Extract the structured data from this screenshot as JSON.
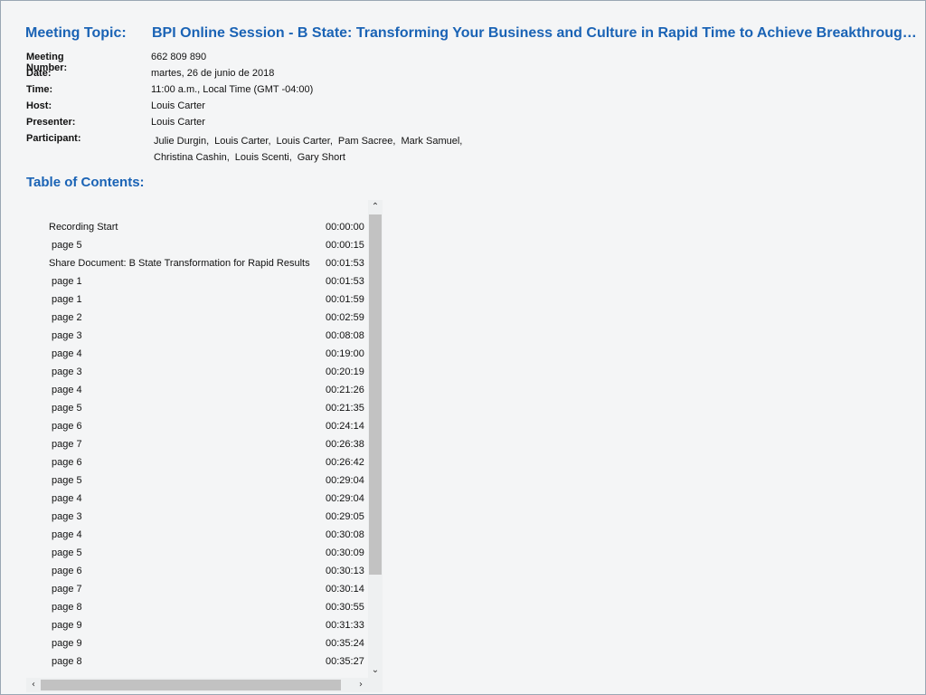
{
  "meeting": {
    "topic_label": "Meeting Topic:",
    "topic_value": "BPI Online Session - B State: Transforming Your Business and Culture in Rapid Time to Achieve Breakthrough Me...",
    "info": [
      {
        "label": "Meeting Number:",
        "value": "662 809 890"
      },
      {
        "label": "Date:",
        "value": "martes, 26 de junio de 2018"
      },
      {
        "label": "Time:",
        "value": "11:00 a.m., Local Time (GMT -04:00)"
      },
      {
        "label": "Host:",
        "value": "Louis Carter"
      },
      {
        "label": "Presenter:",
        "value": "Louis Carter"
      }
    ],
    "participant_label": "Participant:",
    "participants": [
      "Julie Durgin,",
      "Louis Carter,",
      "Louis Carter,",
      "Pam Sacree,",
      "Mark Samuel,",
      "Christina Cashin,",
      "Louis Scenti,",
      "Gary Short"
    ]
  },
  "toc": {
    "title": "Table of Contents:",
    "items": [
      {
        "name": "Recording Start",
        "time": "00:00:00",
        "indent": false
      },
      {
        "name": "page 5",
        "time": "00:00:15",
        "indent": true
      },
      {
        "name": "Share Document: B State Transformation for Rapid Results",
        "time": "00:01:53",
        "indent": false
      },
      {
        "name": "page 1",
        "time": "00:01:53",
        "indent": true
      },
      {
        "name": "page 1",
        "time": "00:01:59",
        "indent": true
      },
      {
        "name": "page 2",
        "time": "00:02:59",
        "indent": true
      },
      {
        "name": "page 3",
        "time": "00:08:08",
        "indent": true
      },
      {
        "name": "page 4",
        "time": "00:19:00",
        "indent": true
      },
      {
        "name": "page 3",
        "time": "00:20:19",
        "indent": true
      },
      {
        "name": "page 4",
        "time": "00:21:26",
        "indent": true
      },
      {
        "name": "page 5",
        "time": "00:21:35",
        "indent": true
      },
      {
        "name": "page 6",
        "time": "00:24:14",
        "indent": true
      },
      {
        "name": "page 7",
        "time": "00:26:38",
        "indent": true
      },
      {
        "name": "page 6",
        "time": "00:26:42",
        "indent": true
      },
      {
        "name": "page 5",
        "time": "00:29:04",
        "indent": true
      },
      {
        "name": "page 4",
        "time": "00:29:04",
        "indent": true
      },
      {
        "name": "page 3",
        "time": "00:29:05",
        "indent": true
      },
      {
        "name": "page 4",
        "time": "00:30:08",
        "indent": true
      },
      {
        "name": "page 5",
        "time": "00:30:09",
        "indent": true
      },
      {
        "name": "page 6",
        "time": "00:30:13",
        "indent": true
      },
      {
        "name": "page 7",
        "time": "00:30:14",
        "indent": true
      },
      {
        "name": "page 8",
        "time": "00:30:55",
        "indent": true
      },
      {
        "name": "page 9",
        "time": "00:31:33",
        "indent": true
      },
      {
        "name": "page 9",
        "time": "00:35:24",
        "indent": true
      },
      {
        "name": "page 8",
        "time": "00:35:27",
        "indent": true
      }
    ]
  },
  "scrollbars": {
    "up_arrow": "⌃",
    "down_arrow": "⌄",
    "left_arrow": "‹",
    "right_arrow": "›"
  },
  "icons": {
    "up": "chevron-up-icon",
    "down": "chevron-down-icon",
    "left": "chevron-left-icon",
    "right": "chevron-right-icon"
  },
  "colors": {
    "accent": "#1a63b5",
    "background": "#f4f5f6",
    "scroll_thumb": "#c2c2c2"
  }
}
